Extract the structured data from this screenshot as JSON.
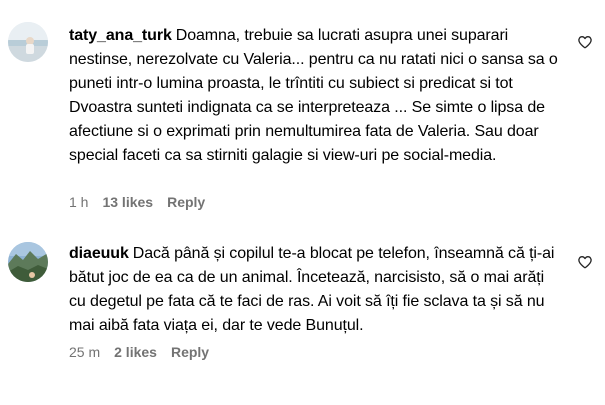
{
  "comments": [
    {
      "username": "taty_ana_turk",
      "text": "Doamna, trebuie sa lucrati asupra unei suparari nestinse, nerezolvate cu Valeria... pentru ca nu ratati nici o sansa sa o puneti intr-o lumina proasta, le trîntiti cu subiect si predicat si tot Dvoastra sunteti indignata ca se interpreteaza ... Se simte o lipsa de afectiune si o exprimati prin nemultumirea fata de Valeria. Sau doar special faceti ca sa stirniti galagie si view-uri pe social-media.",
      "time": "1 h",
      "likes": "13 likes",
      "reply": "Reply",
      "like_icon": "heart-outline-icon"
    },
    {
      "username": "diaeuuk",
      "text": "Dacă până și copilul te-a blocat pe telefon, înseamnă că ți-ai bătut joc de ea ca de un animal. Încetează, narcisisto, să o mai arăți cu degetul pe fata că te faci de ras. Ai voit să îți fie sclava ta și să nu mai aibă fata viața ei, dar te vede Bunuțul.",
      "time": "25 m",
      "likes": "2 likes",
      "reply": "Reply",
      "like_icon": "heart-outline-icon"
    }
  ],
  "colors": {
    "text": "#000000",
    "meta": "#737373",
    "background": "#ffffff"
  }
}
